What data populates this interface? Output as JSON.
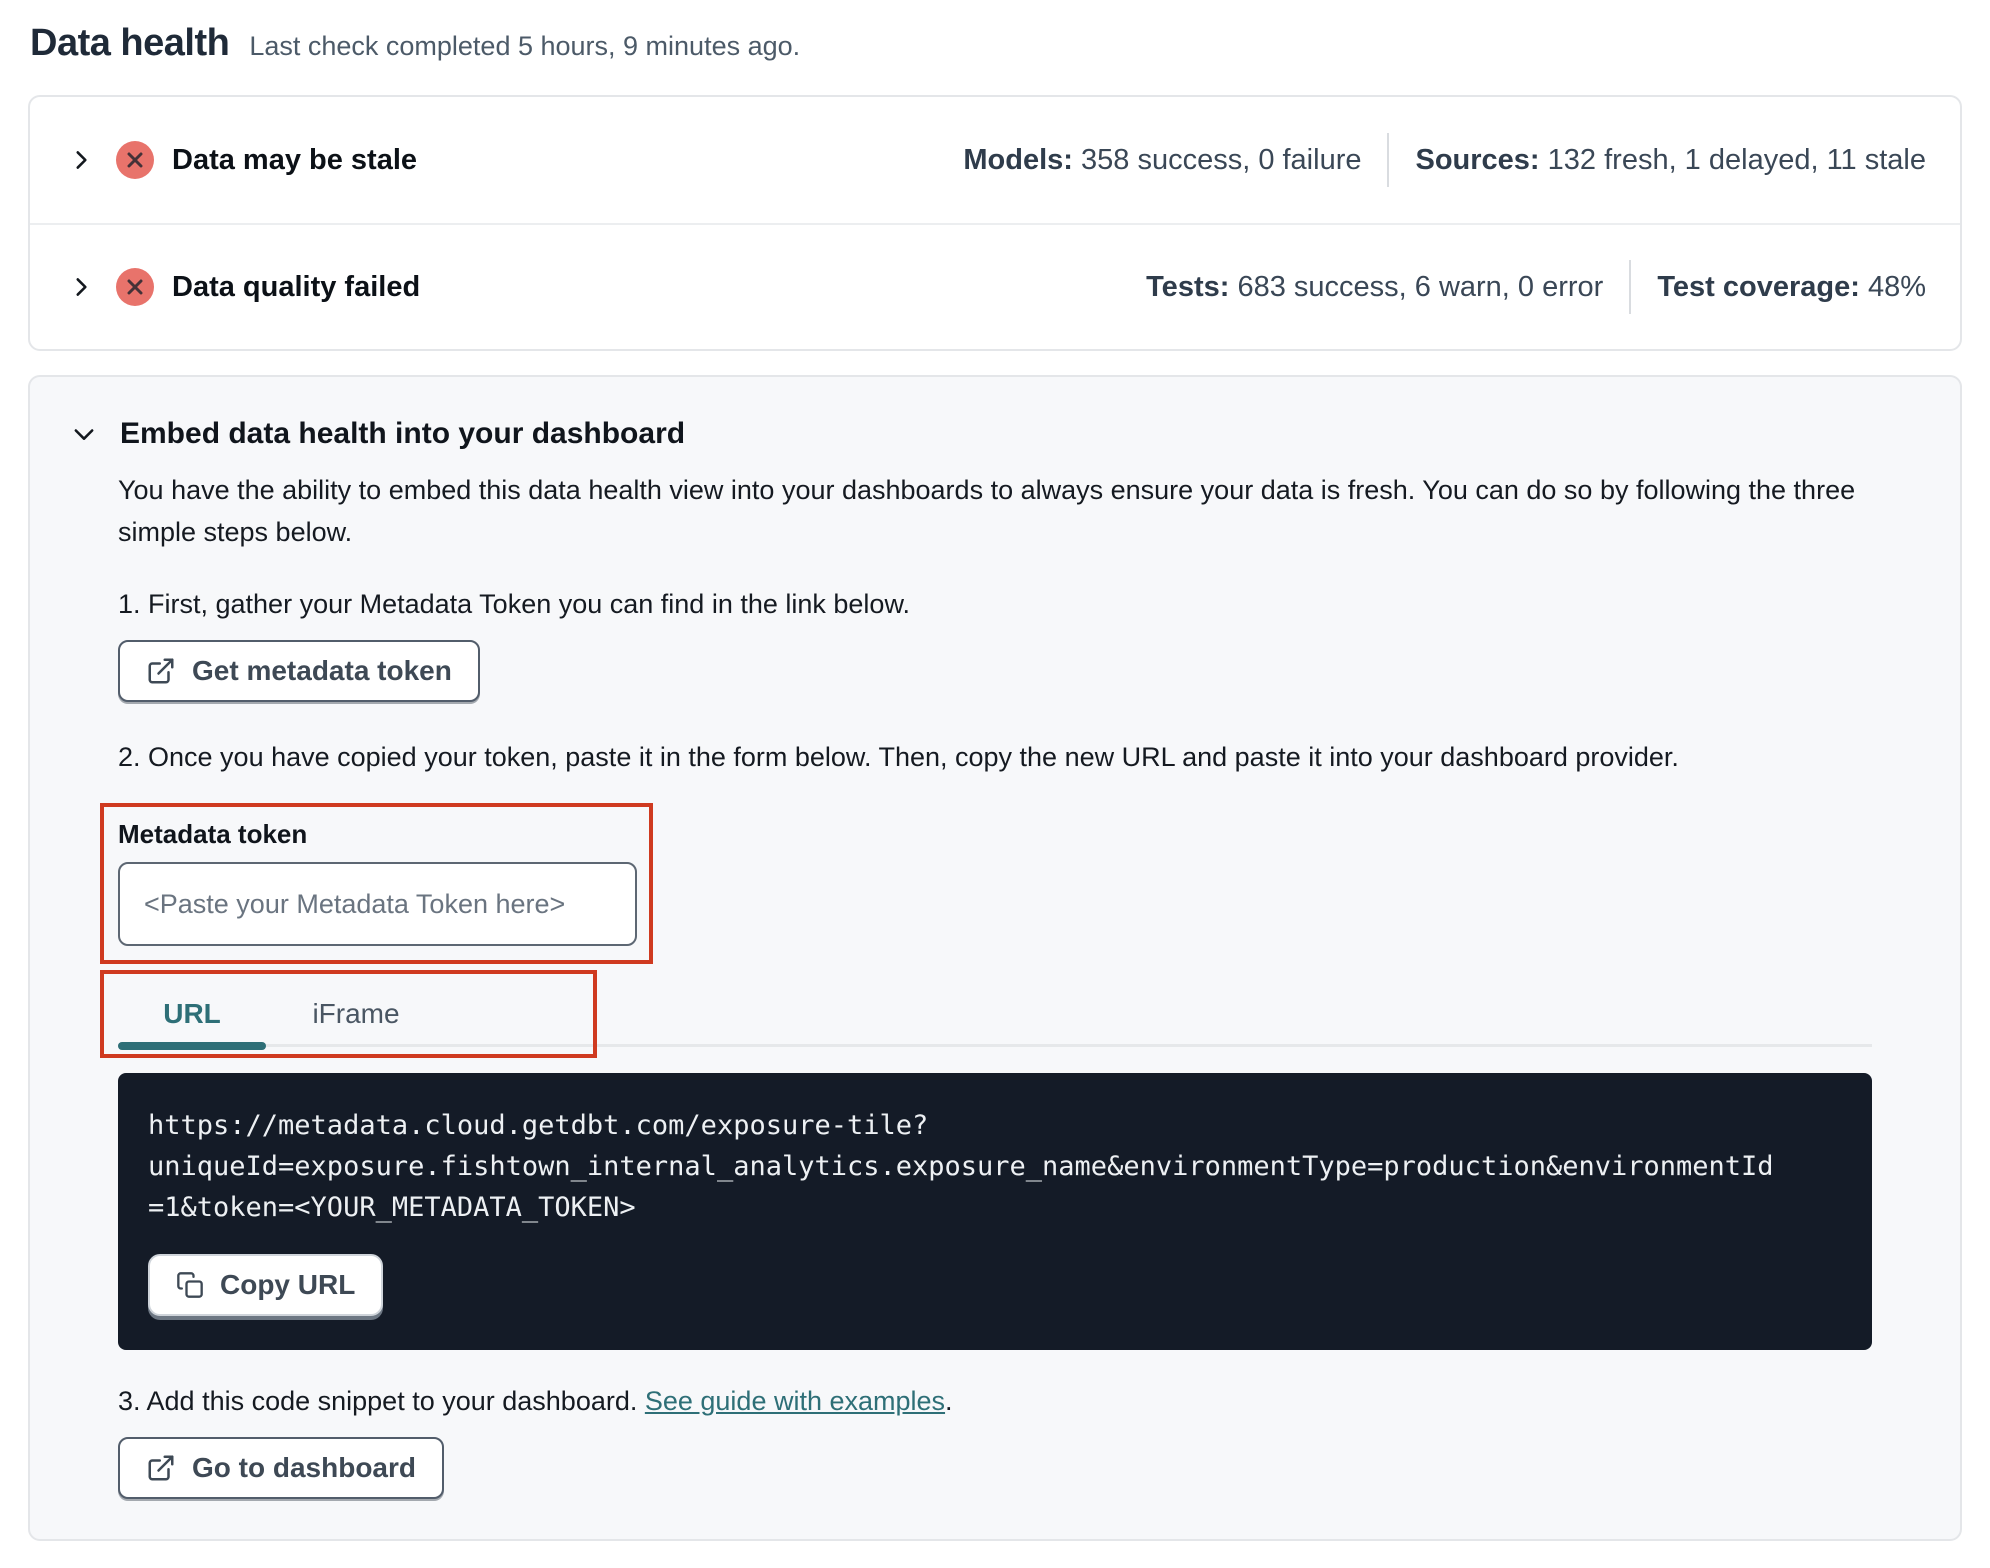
{
  "page": {
    "title": "Data health",
    "subtitle": "Last check completed 5 hours, 9 minutes ago."
  },
  "status_rows": [
    {
      "label": "Data may be stale",
      "status": "error",
      "metrics": [
        {
          "label": "Models:",
          "value": "358 success, 0 failure"
        },
        {
          "label": "Sources:",
          "value": "132 fresh, 1 delayed, 11 stale"
        }
      ]
    },
    {
      "label": "Data quality failed",
      "status": "error",
      "metrics": [
        {
          "label": "Tests:",
          "value": "683 success, 6 warn, 0 error"
        },
        {
          "label": "Test coverage:",
          "value": "48%"
        }
      ]
    }
  ],
  "embed": {
    "title": "Embed data health into your dashboard",
    "description": "You have the ability to embed this data health view into your dashboards to always ensure your data is fresh. You can do so by following the three simple steps below.",
    "step1": "1. First, gather your Metadata Token you can find in the link below.",
    "step2": "2. Once you have copied your token, paste it in the form below. Then, copy the new URL and paste it into your dashboard provider.",
    "token_field": {
      "label": "Metadata token",
      "placeholder": "<Paste your Metadata Token here>",
      "value": ""
    },
    "tabs": [
      {
        "label": "URL",
        "active": true
      },
      {
        "label": "iFrame",
        "active": false
      }
    ],
    "code": {
      "text": "https://metadata.cloud.getdbt.com/exposure-tile?\nuniqueId=exposure.fishtown_internal_analytics.exposure_name&environmentType=production&environmentId\n=1&token=<YOUR_METADATA_TOKEN>"
    },
    "step3": {
      "prefix": "3. Add this code snippet to your dashboard. ",
      "link": "See guide with examples",
      "suffix": "."
    },
    "buttons": {
      "get_token": "Get metadata token",
      "copy_url": "Copy URL",
      "go_to_dashboard": "Go to dashboard"
    }
  },
  "icons": {
    "status": "x-circle-icon",
    "row_expand": "chevron-right-icon",
    "section_collapse": "chevron-down-icon",
    "external_link": "external-link-icon",
    "copy": "copy-icon"
  },
  "colors": {
    "accent_teal": "#2e6f77",
    "annotation_red": "#cf3a20",
    "status_error_bg": "#e8736b",
    "status_error_glyph": "#443238",
    "code_block_bg": "#141b27",
    "card_border": "#e4e6e9",
    "embed_card_bg": "#f7f8fa"
  }
}
